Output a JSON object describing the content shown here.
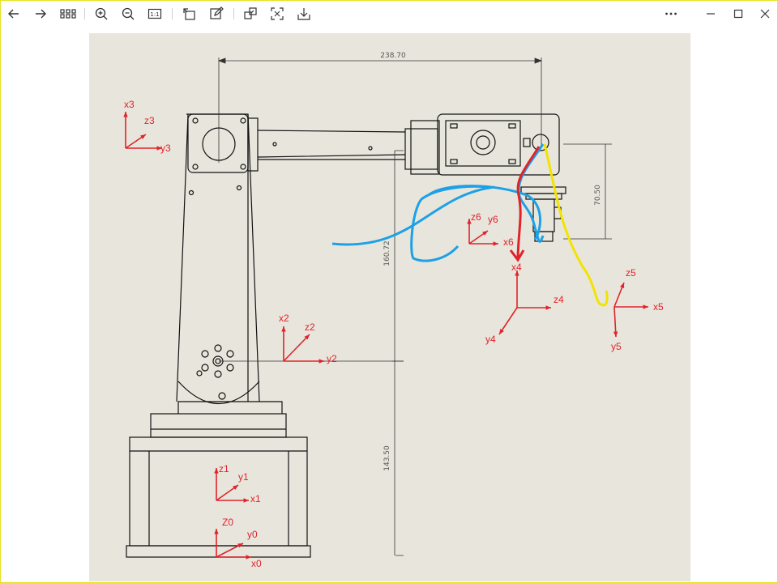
{
  "toolbar": {
    "left_icons": [
      "back-icon",
      "forward-icon",
      "grid-view-icon",
      "zoom-in-icon",
      "zoom-out-icon",
      "actual-size-icon",
      "rotate-icon",
      "edit-icon",
      "crop-icon",
      "fit-screen-icon",
      "save-icon"
    ],
    "actual_size_label": "1:1",
    "window_controls": [
      "more-icon",
      "minimize-icon",
      "maximize-icon",
      "close-icon"
    ]
  },
  "drawing": {
    "dimensions": {
      "top_width": "238.70",
      "right_height": "70.50",
      "upper_arm_height": "160.72",
      "base_height": "143.50"
    },
    "frames": {
      "f0": {
        "z": "Z0",
        "y": "y0",
        "x": "x0"
      },
      "f1": {
        "z": "z1",
        "y": "y1",
        "x": "x1"
      },
      "f2": {
        "z": "z2",
        "y": "y2",
        "x": "x2"
      },
      "f3": {
        "z": "z3",
        "y": "y3",
        "x": "x3"
      },
      "f4": {
        "z": "z4",
        "y": "y4",
        "x": "x4"
      },
      "f5": {
        "z": "z5",
        "y": "y5",
        "x": "x5"
      },
      "f6": {
        "z": "z6",
        "y": "y6",
        "x": "x6"
      }
    },
    "colors": {
      "axes": "#e0232b",
      "annotation_red": "#e0232b",
      "annotation_blue": "#1da1e6",
      "annotation_yellow": "#f2e300",
      "line": "#111111",
      "background": "#e8e6dc"
    }
  }
}
